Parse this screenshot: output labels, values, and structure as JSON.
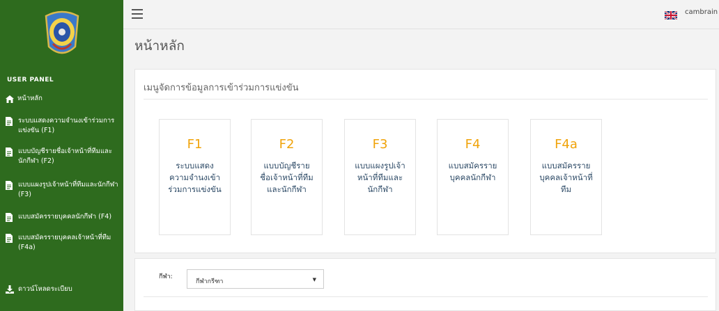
{
  "sidebar": {
    "panel_title": "USER PANEL",
    "items": [
      {
        "label": "หน้าหลัก",
        "icon": "home-icon"
      },
      {
        "label": "ระบบแสดงความจำนงเข้าร่วมการแข่งขัน (F1)",
        "icon": "document-icon"
      },
      {
        "label": "แบบบัญชีรายชื่อเจ้าหน้าที่ทีมและนักกีฬา (F2)",
        "icon": "document-icon"
      },
      {
        "label": "แบบแผงรูปเจ้าหน้าที่ทีมและนักกีฬา (F3)",
        "icon": "document-icon"
      },
      {
        "label": "แบบสมัครรายบุคคลนักกีฬา (F4)",
        "icon": "document-icon"
      },
      {
        "label": "แบบสมัครรายบุคคลเจ้าหน้าที่ทีม (F4a)",
        "icon": "document-icon"
      },
      {
        "label": "ดาวน์โหลดระเบียบ",
        "icon": "download-icon"
      }
    ]
  },
  "header": {
    "user_name": "cambrain",
    "language_flag": "uk-flag-icon"
  },
  "page_title": "หน้าหลัก",
  "menu_card": {
    "title": "เมนูจัดการข้อมูลการเข้าร่วมการแข่งขัน",
    "tiles": [
      {
        "code": "F1",
        "label": "ระบบแสดงความจำนงเข้าร่วมการแข่งขัน"
      },
      {
        "code": "F2",
        "label": "แบบบัญชีรายชื่อเจ้าหน้าที่ทีมและนักกีฬา"
      },
      {
        "code": "F3",
        "label": "แบบแผงรูปเจ้าหน้าที่ทีมและนักกีฬา"
      },
      {
        "code": "F4",
        "label": "แบบสมัครรายบุคคลนักกีฬา"
      },
      {
        "code": "F4a",
        "label": "แบบสมัครรายบุคคลเจ้าหน้าที่ทีม"
      }
    ]
  },
  "filter": {
    "label": "กีฬา:",
    "selected": "กีฬากรีฑา"
  },
  "colors": {
    "sidebar": "#2e6b1e",
    "tile_code": "#f0a30a",
    "tile_label": "#2d4a66"
  }
}
